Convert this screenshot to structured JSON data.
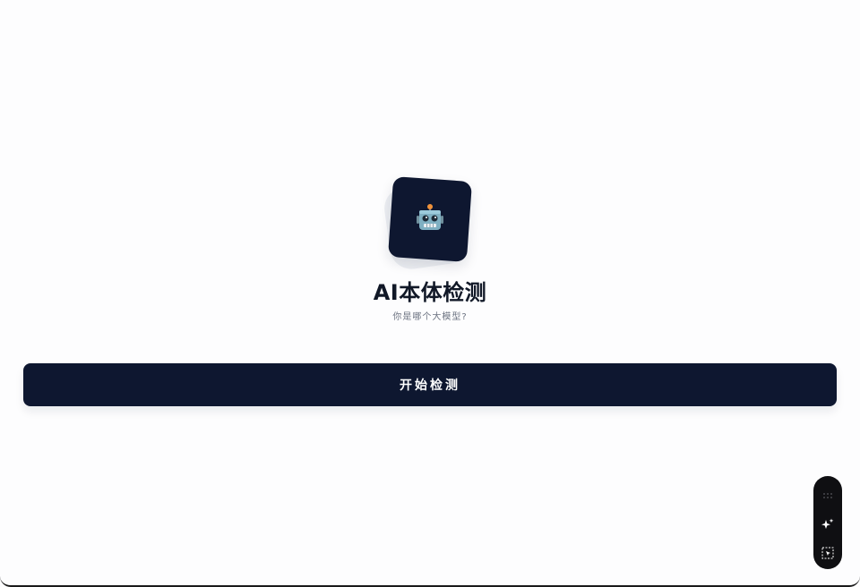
{
  "hero": {
    "title": "AI本体检测",
    "subtitle": "你是哪个大模型?"
  },
  "actions": {
    "start_label": "开始检测"
  },
  "icons": {
    "app_icon": "robot-icon",
    "toolbar": [
      "drag-handle-icon",
      "sparkle-icon",
      "select-cursor-icon"
    ]
  },
  "colors": {
    "primary": "#0e1730",
    "background": "#fdfdfe",
    "title": "#111827",
    "subtitle": "#6b7280",
    "toolbar": "#0f0f12"
  }
}
